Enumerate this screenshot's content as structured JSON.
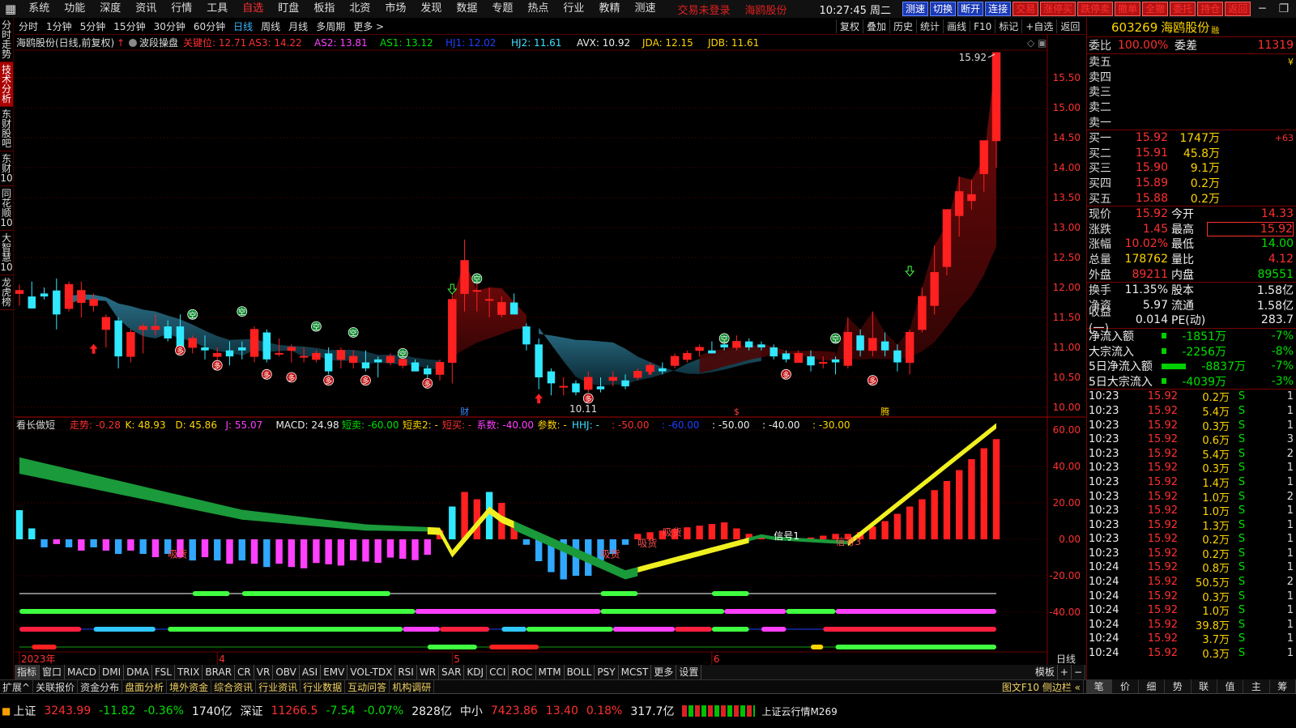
{
  "menu": {
    "items": [
      "系统",
      "功能",
      "深度",
      "资讯",
      "行情",
      "工具",
      "自选",
      "盯盘",
      "板指",
      "北资",
      "市场",
      "发现",
      "数据",
      "专题",
      "热点",
      "行业",
      "教精",
      "测速"
    ],
    "active_index": 6,
    "trade_warning": "交易未登录",
    "stock_warning": "海鸥股份",
    "clock": "10:27:45 周二",
    "toolbar": [
      "测速",
      "切换",
      "断开",
      "连接",
      "交易",
      "涨停买",
      "跌停卖",
      "撤单",
      "全撤",
      "委托",
      "持仓",
      "返回"
    ]
  },
  "left_tabs": [
    "分时走势",
    "技术分析",
    "东财股吧",
    "东财10",
    "同花顺10",
    "大智慧10",
    "龙虎榜"
  ],
  "left_active": 1,
  "periods": {
    "items": [
      "分时",
      "1分钟",
      "5分钟",
      "15分钟",
      "30分钟",
      "60分钟",
      "日线",
      "周线",
      "月线",
      "多周期",
      "更多 >"
    ],
    "active": 6
  },
  "right_tools": [
    "复权",
    "叠加",
    "历史",
    "统计",
    "画线",
    "F10",
    "标记",
    "+自选",
    "返回"
  ],
  "main_chart": {
    "title": "海鸥股份(日线,前复权)",
    "indicator": "波段操盘",
    "params": [
      {
        "t": "关键位: 12.71",
        "c": "#ff3030"
      },
      {
        "t": "AS3: 14.22",
        "c": "#ff3030"
      },
      {
        "t": "AS2: 13.81",
        "c": "#ff40ff"
      },
      {
        "t": "AS1: 13.12",
        "c": "#00e000"
      },
      {
        "t": "HJ1: 12.02",
        "c": "#2040ff"
      },
      {
        "t": "HJ2: 11.61",
        "c": "#40e0ff"
      },
      {
        "t": "AVX: 10.92",
        "c": "#eeeeee"
      },
      {
        "t": "JDA: 12.15",
        "c": "#ffd400"
      },
      {
        "t": "JDB: 11.61",
        "c": "#ffd400"
      }
    ],
    "high_label": "15.92",
    "low_label": "10.11",
    "markers": [
      "财",
      "$",
      "腾"
    ],
    "axis_ticks": [
      "15.50",
      "15.00",
      "14.50",
      "14.00",
      "13.50",
      "13.00",
      "12.50",
      "12.00",
      "11.50",
      "11.00",
      "10.50",
      "10.00"
    ],
    "sign_labels": {
      "kong": "空",
      "duo": "多"
    }
  },
  "sub_chart": {
    "title": "看长做短",
    "params": [
      {
        "t": "走势: -0.28",
        "c": "#ff3030"
      },
      {
        "t": "K: 48.93",
        "c": "#ffd400"
      },
      {
        "t": "D: 45.86",
        "c": "#ffd400"
      },
      {
        "t": "J: 55.07",
        "c": "#ff40ff"
      },
      {
        "t": "MACD: 24.98",
        "c": "#eeeeee"
      },
      {
        "t": "短卖: -60.00",
        "c": "#00e000"
      },
      {
        "t": "短卖2: -",
        "c": "#ffd400"
      },
      {
        "t": "短买: -",
        "c": "#ff3030"
      },
      {
        "t": "系数: -40.00",
        "c": "#ff40ff"
      },
      {
        "t": "参数: -",
        "c": "#ffd400"
      },
      {
        "t": "HHJ: -",
        "c": "#40e0ff"
      },
      {
        "t": ": -50.00",
        "c": "#ff3030"
      },
      {
        "t": ": -60.00",
        "c": "#2040ff"
      },
      {
        "t": ": -50.00",
        "c": "#eeeeee"
      },
      {
        "t": ": -40.00",
        "c": "#eeeeee"
      },
      {
        "t": ": -30.00",
        "c": "#ffd400"
      }
    ],
    "axis_ticks": [
      "60.00",
      "40.00",
      "20.00",
      "0.00",
      "-20.00",
      "-40.00"
    ],
    "labels": [
      "吸货",
      "吸货",
      "吸货",
      "吸货",
      "信号1",
      "信号3"
    ],
    "period": "日线",
    "date_labels": [
      "2023年",
      "4",
      "5",
      "6"
    ]
  },
  "bottom_tabs": [
    "指标",
    "窗口",
    "MACD",
    "DMI",
    "DMA",
    "FSL",
    "TRIX",
    "BRAR",
    "CR",
    "VR",
    "OBV",
    "ASI",
    "EMV",
    "VOL-TDX",
    "RSI",
    "WR",
    "SAR",
    "KDJ",
    "CCI",
    "ROC",
    "MTM",
    "BOLL",
    "PSY",
    "MCST",
    "更多",
    "设置"
  ],
  "bottom_right": [
    "模板",
    "+",
    "−"
  ],
  "ext_bar": [
    "扩展^",
    "关联报价",
    "资金分布",
    "盘面分析",
    "境外资金",
    "综合资讯",
    "行业资讯",
    "行业数据",
    "互动问答",
    "机构调研"
  ],
  "ext_right": "图文F10 侧边栏 «",
  "status": {
    "sh_name": "上证",
    "sh_val": "3243.99",
    "sh_chg": "-11.82",
    "sh_pct": "-0.36%",
    "sh_amt": "1740亿",
    "sz_name": "深证",
    "sz_val": "11266.5",
    "sz_chg": "-7.54",
    "sz_pct": "-0.07%",
    "sz_amt": "2828亿",
    "zx_name": "中小",
    "zx_val": "7423.86",
    "zx_chg": "13.40",
    "zx_pct": "0.18%",
    "zx_amt": "317.7亿",
    "cloud": "上证云行情M269"
  },
  "quote": {
    "code": "603269",
    "name": "海鸥股份",
    "badge": "融",
    "weibi_label": "委比",
    "weibi": "100.00%",
    "weicha_label": "委差",
    "weicha": "11319",
    "asks": [
      {
        "l": "卖五",
        "p": "",
        "v": ""
      },
      {
        "l": "卖四",
        "p": "",
        "v": ""
      },
      {
        "l": "卖三",
        "p": "",
        "v": ""
      },
      {
        "l": "卖二",
        "p": "",
        "v": ""
      },
      {
        "l": "卖一",
        "p": "",
        "v": ""
      }
    ],
    "ask_flag": "¥",
    "bids": [
      {
        "l": "买一",
        "p": "15.92",
        "v": "1747万",
        "c": "+63"
      },
      {
        "l": "买二",
        "p": "15.91",
        "v": "45.8万",
        "c": ""
      },
      {
        "l": "买三",
        "p": "15.90",
        "v": "9.1万",
        "c": ""
      },
      {
        "l": "买四",
        "p": "15.89",
        "v": "0.2万",
        "c": ""
      },
      {
        "l": "买五",
        "p": "15.88",
        "v": "0.2万",
        "c": ""
      }
    ],
    "stats": [
      [
        "现价",
        "15.92",
        "今开",
        "14.33"
      ],
      [
        "涨跌",
        "1.45",
        "最高",
        "15.92"
      ],
      [
        "涨幅",
        "10.02%",
        "最低",
        "14.00"
      ],
      [
        "总量",
        "178762",
        "量比",
        "4.12"
      ],
      [
        "外盘",
        "89211",
        "内盘",
        "89551"
      ]
    ],
    "stats2": [
      [
        "换手",
        "11.35%",
        "股本",
        "1.58亿"
      ],
      [
        "净资",
        "5.97",
        "流通",
        "1.58亿"
      ],
      [
        "收益(一)",
        "0.014",
        "PE(动)",
        "283.7"
      ]
    ],
    "flows": [
      {
        "l": "净流入额",
        "v": "-1851万",
        "p": "-7%"
      },
      {
        "l": "大宗流入",
        "v": "-2256万",
        "p": "-8%"
      },
      {
        "l": "5日净流入额",
        "v": "-8837万",
        "p": "-7%"
      },
      {
        "l": "5日大宗流入",
        "v": "-4039万",
        "p": "-3%"
      }
    ],
    "ticks": [
      [
        "10:23",
        "15.92",
        "0.2万",
        "S",
        "1"
      ],
      [
        "10:23",
        "15.92",
        "5.4万",
        "S",
        "1"
      ],
      [
        "10:23",
        "15.92",
        "0.3万",
        "S",
        "1"
      ],
      [
        "10:23",
        "15.92",
        "0.6万",
        "S",
        "3"
      ],
      [
        "10:23",
        "15.92",
        "5.4万",
        "S",
        "2"
      ],
      [
        "10:23",
        "15.92",
        "0.3万",
        "S",
        "1"
      ],
      [
        "10:23",
        "15.92",
        "1.4万",
        "S",
        "1"
      ],
      [
        "10:23",
        "15.92",
        "1.0万",
        "S",
        "2"
      ],
      [
        "10:23",
        "15.92",
        "1.0万",
        "S",
        "1"
      ],
      [
        "10:23",
        "15.92",
        "1.3万",
        "S",
        "1"
      ],
      [
        "10:23",
        "15.92",
        "0.2万",
        "S",
        "1"
      ],
      [
        "10:23",
        "15.92",
        "0.2万",
        "S",
        "1"
      ],
      [
        "10:24",
        "15.92",
        "0.8万",
        "S",
        "1"
      ],
      [
        "10:24",
        "15.92",
        "50.5万",
        "S",
        "2"
      ],
      [
        "10:24",
        "15.92",
        "0.3万",
        "S",
        "1"
      ],
      [
        "10:24",
        "15.92",
        "1.0万",
        "S",
        "1"
      ],
      [
        "10:24",
        "15.92",
        "39.8万",
        "S",
        "1"
      ],
      [
        "10:24",
        "15.92",
        "3.7万",
        "S",
        "1"
      ],
      [
        "10:24",
        "15.92",
        "0.3万",
        "S",
        "1"
      ]
    ],
    "tabs": [
      "笔",
      "价",
      "细",
      "势",
      "联",
      "值",
      "主",
      "筹"
    ]
  },
  "chart_data": {
    "type": "candlestick",
    "ylim": [
      10.0,
      15.92
    ],
    "candles": [
      [
        11.9,
        12.05,
        11.7,
        11.95
      ],
      [
        11.85,
        12.1,
        11.7,
        11.65
      ],
      [
        11.9,
        12.0,
        11.8,
        11.85
      ],
      [
        11.95,
        12.15,
        11.3,
        11.55
      ],
      [
        11.65,
        12.1,
        11.6,
        12.05
      ],
      [
        11.75,
        12.1,
        11.5,
        11.95
      ],
      [
        11.7,
        11.9,
        11.6,
        11.8
      ],
      [
        11.3,
        11.55,
        11.0,
        11.5
      ],
      [
        11.45,
        11.5,
        10.65,
        10.85
      ],
      [
        10.85,
        11.3,
        10.75,
        11.25
      ],
      [
        11.3,
        11.4,
        10.9,
        11.35
      ],
      [
        11.3,
        11.55,
        11.2,
        11.35
      ],
      [
        11.35,
        11.45,
        11.1,
        11.15
      ],
      [
        11.35,
        11.55,
        11.2,
        10.95
      ],
      [
        11.0,
        11.2,
        10.9,
        11.15
      ],
      [
        11.0,
        11.2,
        10.8,
        10.95
      ],
      [
        10.85,
        11.0,
        10.65,
        10.9
      ],
      [
        10.95,
        11.1,
        10.7,
        10.85
      ],
      [
        11.0,
        11.1,
        10.8,
        10.95
      ],
      [
        10.85,
        11.35,
        10.75,
        11.3
      ],
      [
        11.25,
        11.3,
        10.75,
        10.8
      ],
      [
        10.9,
        11.15,
        10.85,
        10.9
      ],
      [
        10.95,
        11.05,
        10.75,
        11.0
      ],
      [
        10.85,
        11.0,
        10.75,
        10.85
      ],
      [
        10.8,
        10.95,
        10.75,
        10.9
      ],
      [
        10.9,
        11.0,
        10.55,
        10.6
      ],
      [
        10.8,
        11.0,
        10.65,
        10.95
      ],
      [
        10.75,
        10.95,
        10.65,
        10.85
      ],
      [
        10.75,
        10.95,
        10.6,
        10.65
      ],
      [
        10.8,
        10.85,
        10.5,
        10.75
      ],
      [
        10.75,
        10.9,
        10.7,
        10.85
      ],
      [
        10.7,
        10.85,
        10.65,
        10.8
      ],
      [
        10.75,
        10.8,
        10.6,
        10.6
      ],
      [
        10.65,
        10.7,
        10.45,
        10.55
      ],
      [
        10.55,
        10.8,
        10.45,
        10.75
      ],
      [
        10.75,
        11.9,
        10.4,
        11.8
      ],
      [
        11.9,
        12.8,
        11.6,
        12.45
      ],
      [
        11.95,
        12.1,
        11.6,
        11.95
      ],
      [
        11.8,
        12.0,
        11.5,
        11.8
      ],
      [
        11.55,
        11.85,
        11.5,
        11.75
      ],
      [
        11.75,
        11.9,
        11.55,
        11.55
      ],
      [
        11.35,
        11.4,
        10.95,
        11.05
      ],
      [
        11.05,
        11.15,
        10.3,
        10.5
      ],
      [
        10.6,
        10.65,
        10.2,
        10.4
      ],
      [
        10.35,
        10.5,
        10.2,
        10.35
      ],
      [
        10.4,
        10.45,
        10.2,
        10.25
      ],
      [
        10.3,
        10.6,
        10.25,
        10.5
      ],
      [
        10.35,
        10.5,
        10.25,
        10.3
      ],
      [
        10.45,
        10.6,
        10.35,
        10.5
      ],
      [
        10.45,
        10.55,
        10.3,
        10.35
      ],
      [
        10.5,
        10.65,
        10.45,
        10.6
      ],
      [
        10.6,
        10.75,
        10.55,
        10.7
      ],
      [
        10.65,
        10.75,
        10.55,
        10.6
      ],
      [
        10.7,
        10.9,
        10.65,
        10.85
      ],
      [
        10.8,
        10.95,
        10.75,
        10.9
      ],
      [
        10.95,
        11.05,
        10.85,
        11.0
      ],
      [
        10.95,
        11.1,
        10.9,
        10.9
      ],
      [
        11.05,
        11.1,
        10.95,
        11.0
      ],
      [
        11.0,
        11.2,
        10.95,
        11.1
      ],
      [
        11.1,
        11.15,
        10.95,
        11.0
      ],
      [
        11.05,
        11.1,
        10.95,
        11.0
      ],
      [
        11.0,
        11.05,
        10.8,
        10.85
      ],
      [
        10.9,
        10.95,
        10.75,
        10.8
      ],
      [
        10.75,
        10.95,
        10.75,
        10.9
      ],
      [
        10.85,
        10.95,
        10.6,
        10.7
      ],
      [
        10.75,
        10.85,
        10.65,
        10.75
      ],
      [
        10.8,
        10.85,
        10.55,
        10.75
      ],
      [
        10.7,
        11.5,
        10.65,
        11.25
      ],
      [
        11.2,
        11.3,
        10.85,
        10.95
      ],
      [
        10.95,
        11.6,
        10.85,
        11.15
      ],
      [
        11.1,
        11.25,
        10.85,
        10.95
      ],
      [
        10.95,
        11.05,
        10.6,
        10.75
      ],
      [
        10.75,
        11.3,
        10.55,
        11.25
      ],
      [
        11.3,
        12.0,
        11.25,
        11.85
      ],
      [
        11.7,
        12.7,
        11.55,
        12.25
      ],
      [
        12.35,
        13.05,
        12.2,
        13.3
      ],
      [
        13.2,
        13.85,
        12.85,
        13.6
      ],
      [
        13.45,
        13.8,
        13.3,
        13.55
      ],
      [
        13.9,
        14.15,
        13.6,
        14.45
      ],
      [
        14.45,
        15.92,
        14.0,
        15.92
      ]
    ],
    "vol_ratio_note": "price high 15.92 at last bar"
  }
}
